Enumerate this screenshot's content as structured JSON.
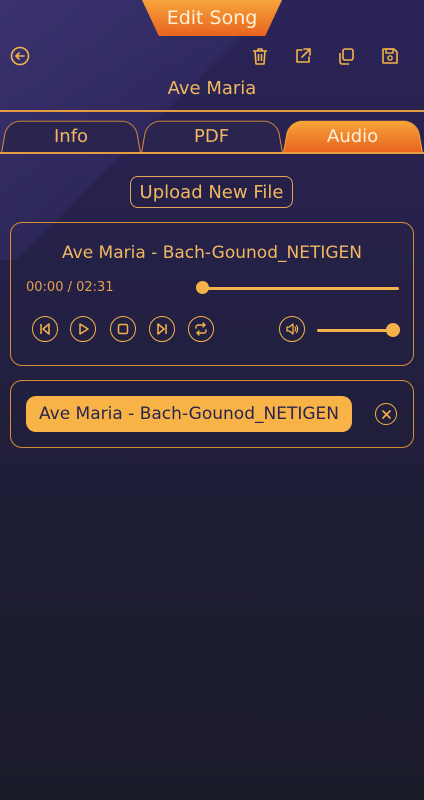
{
  "header": {
    "title": "Edit Song",
    "icons": [
      "back-icon",
      "trash-icon",
      "share-icon",
      "copy-icon",
      "save-icon"
    ]
  },
  "song": {
    "title": "Ave Maria"
  },
  "tabs": [
    {
      "label": "Info",
      "active": false
    },
    {
      "label": "PDF",
      "active": false
    },
    {
      "label": "Audio",
      "active": true
    }
  ],
  "upload_button": {
    "label": "Upload New File"
  },
  "player": {
    "track_title": "Ave Maria - Bach-Gounod_NETIGEN",
    "time_display": "00:00 / 02:31",
    "progress_fraction": 0.0,
    "volume_fraction": 1.0,
    "controls": [
      "skip-previous-icon",
      "play-icon",
      "stop-icon",
      "skip-next-icon",
      "repeat-icon",
      "volume-icon"
    ]
  },
  "attached_file": {
    "name": "Ave Maria - Bach-Gounod_NETIGEN"
  },
  "colors": {
    "accent": "#f5b24a",
    "accent_orange": "#e8641f",
    "background_top": "#2b2459",
    "background_bottom": "#1b1c2a"
  }
}
